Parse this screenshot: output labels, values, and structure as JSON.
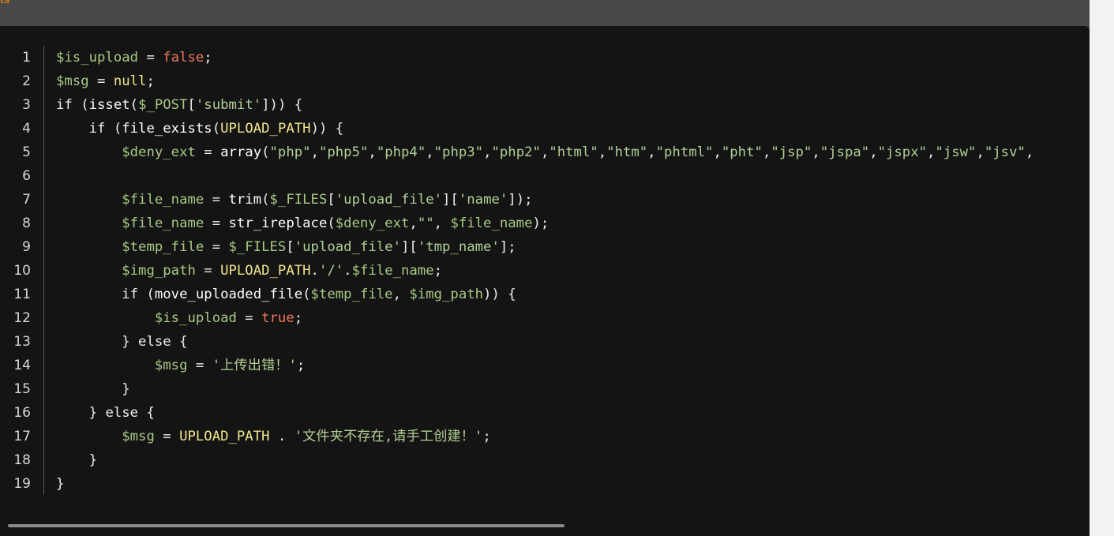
{
  "header": {
    "partial_label": "ts"
  },
  "code": {
    "language": "php",
    "lines": [
      {
        "n": "1",
        "indent": 0,
        "tokens": [
          [
            "var",
            "$is_upload"
          ],
          [
            "p",
            " = "
          ],
          [
            "bool",
            "false"
          ],
          [
            "p",
            ";"
          ]
        ]
      },
      {
        "n": "2",
        "indent": 0,
        "tokens": [
          [
            "var",
            "$msg"
          ],
          [
            "p",
            " = "
          ],
          [
            "null",
            "null"
          ],
          [
            "p",
            ";"
          ]
        ]
      },
      {
        "n": "3",
        "indent": 0,
        "tokens": [
          [
            "kw",
            "if"
          ],
          [
            "p",
            " ("
          ],
          [
            "fn",
            "isset"
          ],
          [
            "p",
            "("
          ],
          [
            "var",
            "$_POST"
          ],
          [
            "p",
            "["
          ],
          [
            "str",
            "'submit'"
          ],
          [
            "p",
            "])) {"
          ]
        ]
      },
      {
        "n": "4",
        "indent": 4,
        "tokens": [
          [
            "kw",
            "if"
          ],
          [
            "p",
            " ("
          ],
          [
            "fn",
            "file_exists"
          ],
          [
            "p",
            "("
          ],
          [
            "const",
            "UPLOAD_PATH"
          ],
          [
            "p",
            ")) {"
          ]
        ]
      },
      {
        "n": "5",
        "indent": 8,
        "tokens": [
          [
            "var",
            "$deny_ext"
          ],
          [
            "p",
            " = "
          ],
          [
            "fn",
            "array"
          ],
          [
            "p",
            "("
          ],
          [
            "str",
            "\"php\""
          ],
          [
            "p",
            ","
          ],
          [
            "str",
            "\"php5\""
          ],
          [
            "p",
            ","
          ],
          [
            "str",
            "\"php4\""
          ],
          [
            "p",
            ","
          ],
          [
            "str",
            "\"php3\""
          ],
          [
            "p",
            ","
          ],
          [
            "str",
            "\"php2\""
          ],
          [
            "p",
            ","
          ],
          [
            "str",
            "\"html\""
          ],
          [
            "p",
            ","
          ],
          [
            "str",
            "\"htm\""
          ],
          [
            "p",
            ","
          ],
          [
            "str",
            "\"phtml\""
          ],
          [
            "p",
            ","
          ],
          [
            "str",
            "\"pht\""
          ],
          [
            "p",
            ","
          ],
          [
            "str",
            "\"jsp\""
          ],
          [
            "p",
            ","
          ],
          [
            "str",
            "\"jspa\""
          ],
          [
            "p",
            ","
          ],
          [
            "str",
            "\"jspx\""
          ],
          [
            "p",
            ","
          ],
          [
            "str",
            "\"jsw\""
          ],
          [
            "p",
            ","
          ],
          [
            "str",
            "\"jsv\""
          ],
          [
            "p",
            ","
          ]
        ]
      },
      {
        "n": "6",
        "indent": 0,
        "tokens": []
      },
      {
        "n": "7",
        "indent": 8,
        "tokens": [
          [
            "var",
            "$file_name"
          ],
          [
            "p",
            " = "
          ],
          [
            "fn",
            "trim"
          ],
          [
            "p",
            "("
          ],
          [
            "var",
            "$_FILES"
          ],
          [
            "p",
            "["
          ],
          [
            "str",
            "'upload_file'"
          ],
          [
            "p",
            "]["
          ],
          [
            "str",
            "'name'"
          ],
          [
            "p",
            "]);"
          ]
        ]
      },
      {
        "n": "8",
        "indent": 8,
        "tokens": [
          [
            "var",
            "$file_name"
          ],
          [
            "p",
            " = "
          ],
          [
            "fn",
            "str_ireplace"
          ],
          [
            "p",
            "("
          ],
          [
            "var",
            "$deny_ext"
          ],
          [
            "p",
            ","
          ],
          [
            "str",
            "\"\""
          ],
          [
            "p",
            ", "
          ],
          [
            "var",
            "$file_name"
          ],
          [
            "p",
            ");"
          ]
        ]
      },
      {
        "n": "9",
        "indent": 8,
        "tokens": [
          [
            "var",
            "$temp_file"
          ],
          [
            "p",
            " = "
          ],
          [
            "var",
            "$_FILES"
          ],
          [
            "p",
            "["
          ],
          [
            "str",
            "'upload_file'"
          ],
          [
            "p",
            "]["
          ],
          [
            "str",
            "'tmp_name'"
          ],
          [
            "p",
            "];"
          ]
        ]
      },
      {
        "n": "10",
        "indent": 8,
        "tokens": [
          [
            "var",
            "$img_path"
          ],
          [
            "p",
            " = "
          ],
          [
            "const",
            "UPLOAD_PATH"
          ],
          [
            "p",
            "."
          ],
          [
            "str",
            "'/'"
          ],
          [
            "p",
            "."
          ],
          [
            "var",
            "$file_name"
          ],
          [
            "p",
            ";"
          ]
        ]
      },
      {
        "n": "11",
        "indent": 8,
        "tokens": [
          [
            "kw",
            "if"
          ],
          [
            "p",
            " ("
          ],
          [
            "fn",
            "move_uploaded_file"
          ],
          [
            "p",
            "("
          ],
          [
            "var",
            "$temp_file"
          ],
          [
            "p",
            ", "
          ],
          [
            "var",
            "$img_path"
          ],
          [
            "p",
            ")) {"
          ]
        ]
      },
      {
        "n": "12",
        "indent": 12,
        "tokens": [
          [
            "var",
            "$is_upload"
          ],
          [
            "p",
            " = "
          ],
          [
            "bool",
            "true"
          ],
          [
            "p",
            ";"
          ]
        ]
      },
      {
        "n": "13",
        "indent": 8,
        "tokens": [
          [
            "p",
            "} "
          ],
          [
            "kw",
            "else"
          ],
          [
            "p",
            " {"
          ]
        ]
      },
      {
        "n": "14",
        "indent": 12,
        "tokens": [
          [
            "var",
            "$msg"
          ],
          [
            "p",
            " = "
          ],
          [
            "str",
            "'上传出错！'"
          ],
          [
            "p",
            ";"
          ]
        ]
      },
      {
        "n": "15",
        "indent": 8,
        "tokens": [
          [
            "p",
            "}"
          ]
        ]
      },
      {
        "n": "16",
        "indent": 4,
        "tokens": [
          [
            "p",
            "} "
          ],
          [
            "kw",
            "else"
          ],
          [
            "p",
            " {"
          ]
        ]
      },
      {
        "n": "17",
        "indent": 8,
        "tokens": [
          [
            "var",
            "$msg"
          ],
          [
            "p",
            " = "
          ],
          [
            "const",
            "UPLOAD_PATH"
          ],
          [
            "p",
            " . "
          ],
          [
            "str",
            "'文件夹不存在,请手工创建！'"
          ],
          [
            "p",
            ";"
          ]
        ]
      },
      {
        "n": "18",
        "indent": 4,
        "tokens": [
          [
            "p",
            "}"
          ]
        ]
      },
      {
        "n": "19",
        "indent": 0,
        "tokens": [
          [
            "p",
            "}"
          ]
        ]
      }
    ]
  },
  "colors": {
    "background": "#484848",
    "panel": "#141414",
    "variable": "#a8c983",
    "boolean": "#f0765a",
    "string": "#b2cf95",
    "constant": "#f0e68c"
  }
}
